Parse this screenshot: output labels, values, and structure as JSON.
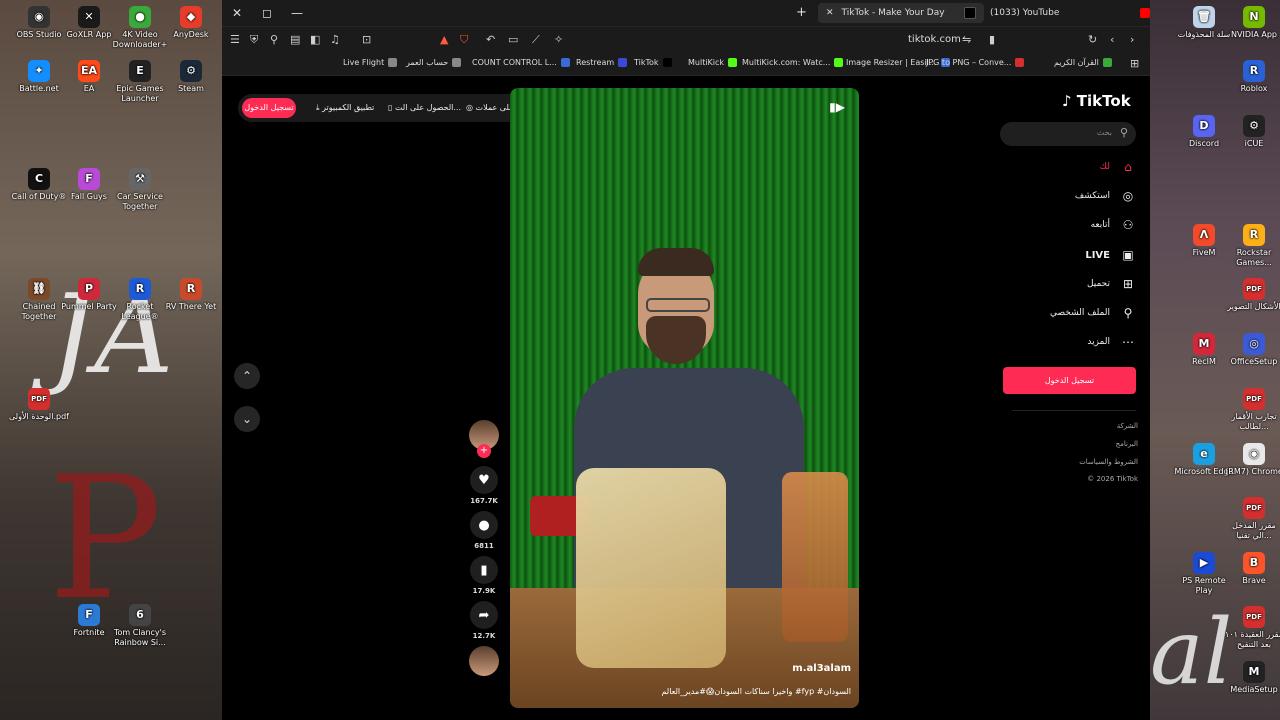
{
  "desktop": {
    "left_icons": [
      {
        "label": "OBS Studio",
        "color": "#333333",
        "glyph": "◉"
      },
      {
        "label": "GoXLR App",
        "color": "#1a1a1a",
        "glyph": "✕"
      },
      {
        "label": "4K Video Downloader+",
        "color": "#3aa83a",
        "glyph": "●"
      },
      {
        "label": "AnyDesk",
        "color": "#e63c2c",
        "glyph": "◆"
      },
      {
        "label": "Battle.net",
        "color": "#148eff",
        "glyph": "✦"
      },
      {
        "label": "EA",
        "color": "#ff4a1a",
        "glyph": "EA"
      },
      {
        "label": "Epic Games Launcher",
        "color": "#222222",
        "glyph": "E"
      },
      {
        "label": "Steam",
        "color": "#1b2838",
        "glyph": "⚙"
      },
      {
        "label": "Call of Duty®",
        "color": "#111111",
        "glyph": "C"
      },
      {
        "label": "Fall Guys",
        "color": "#b84ad6",
        "glyph": "F"
      },
      {
        "label": "Car Service Together",
        "color": "#666666",
        "glyph": "⚒"
      },
      {
        "label": "Chained Together",
        "color": "#7a4a2a",
        "glyph": "⛓"
      },
      {
        "label": "Pummel Party",
        "color": "#cc2a3a",
        "glyph": "P"
      },
      {
        "label": "Rocket League®",
        "color": "#1e5ad6",
        "glyph": "R"
      },
      {
        "label": "RV There Yet",
        "color": "#c84a2a",
        "glyph": "R"
      },
      {
        "label": "الوحدة الأولى.pdf",
        "color": "#d32f2f",
        "glyph": "PDF"
      },
      {
        "label": "Fortnite",
        "color": "#2a7ad6",
        "glyph": "F"
      },
      {
        "label": "Tom Clancy's Rainbow Si...",
        "color": "#444444",
        "glyph": "6"
      }
    ],
    "right_icons": [
      {
        "label": "سلة المحذوفات",
        "color": "#bfd4ea",
        "glyph": "🗑"
      },
      {
        "label": "NVIDIA App",
        "color": "#76b900",
        "glyph": "N"
      },
      {
        "label": "Roblox",
        "color": "#2a62d6",
        "glyph": "R"
      },
      {
        "label": "Discord",
        "color": "#5865f2",
        "glyph": "D"
      },
      {
        "label": "iCUE",
        "color": "#222222",
        "glyph": "⚙"
      },
      {
        "label": "FiveM",
        "color": "#f24a2a",
        "glyph": "Λ"
      },
      {
        "label": "Rockstar Games...",
        "color": "#fcaf17",
        "glyph": "R"
      },
      {
        "label": "الأشكال التصوير",
        "color": "#d32f2f",
        "glyph": "PDF"
      },
      {
        "label": "RecIM",
        "color": "#d6263a",
        "glyph": "M"
      },
      {
        "label": "OfficeSetup",
        "color": "#3a5ad6",
        "glyph": "◎"
      },
      {
        "label": "تجارب الأقمار ...لطالب",
        "color": "#d32f2f",
        "glyph": "PDF"
      },
      {
        "label": "Microsoft Edge",
        "color": "#1aa0e0",
        "glyph": "e"
      },
      {
        "label": "(RM7) Chrome",
        "color": "#e8e8e8",
        "glyph": "◉"
      },
      {
        "label": "مقرر المدخل ...الي تقنيا",
        "color": "#d32f2f",
        "glyph": "PDF"
      },
      {
        "label": "PS Remote Play",
        "color": "#1a4ad6",
        "glyph": "▶"
      },
      {
        "label": "Brave",
        "color": "#fb542b",
        "glyph": "B"
      },
      {
        "label": "مقرر العقيدة ١٠١ بعد التنقيح",
        "color": "#d32f2f",
        "glyph": "PDF"
      },
      {
        "label": "MediaSetup",
        "color": "#222222",
        "glyph": "M"
      }
    ],
    "deco_text": {
      "left_big": "JA",
      "left_red": "P",
      "right_big": "al"
    }
  },
  "browser": {
    "tabs": [
      {
        "label": "TikTok - Make Your Day",
        "active": true,
        "fav_color": "#000000"
      },
      {
        "label": "(1033) YouTube",
        "active": false,
        "fav_color": "#ff0000"
      }
    ],
    "window_controls": {
      "close": "✕",
      "maximize": "◻",
      "minimize": "—"
    },
    "new_tab": "+",
    "url": "tiktok.com",
    "bookmarks": [
      {
        "label": "Live Flight",
        "color": "#888888"
      },
      {
        "label": "حساب العمر",
        "color": "#888888"
      },
      {
        "label": "COUNT CONTROL L...",
        "color": "#3a6ad6"
      },
      {
        "label": "Restream",
        "color": "#3a4ad6"
      },
      {
        "label": "TikTok",
        "color": "#000000"
      },
      {
        "label": "MultiKick",
        "color": "#53fc18"
      },
      {
        "label": "MultiKick.com: Watc...",
        "color": "#53fc18"
      },
      {
        "label": "Image Resizer | Easil...",
        "color": "#3a6ad6"
      },
      {
        "label": "JPG to PNG – Conve...",
        "color": "#d32f2f"
      },
      {
        "label": "القرآن الكريم",
        "color": "#3aa83a"
      }
    ]
  },
  "tiktok": {
    "logo": "TikTok",
    "top_links": {
      "login": "تسجيل الدخول",
      "desktop_app": "تطبيق الكمبيوتر",
      "get_app": "الحصول على الت...",
      "coins": "احصل على عملات"
    },
    "search_placeholder": "بحث",
    "nav": [
      {
        "label": "لك",
        "icon": "home-icon",
        "glyph": "⌂",
        "active": true
      },
      {
        "label": "استكشف",
        "icon": "compass-icon",
        "glyph": "◎",
        "active": false
      },
      {
        "label": "أتابعه",
        "icon": "user-plus-icon",
        "glyph": "⚇",
        "active": false
      },
      {
        "label": "LIVE",
        "icon": "live-tv-icon",
        "glyph": "▣",
        "active": false
      },
      {
        "label": "تحميل",
        "icon": "upload-icon",
        "glyph": "⊞",
        "active": false
      },
      {
        "label": "الملف الشخصي",
        "icon": "profile-icon",
        "glyph": "⚲",
        "active": false
      },
      {
        "label": "المزيد",
        "icon": "more-icon",
        "glyph": "⋯",
        "active": false
      }
    ],
    "login_button": "تسجيل الدخول",
    "footer": {
      "company": "الشركة",
      "program": "البرنامج",
      "terms": "الشروط والسياسات",
      "copyright": "© 2026 TikTok"
    },
    "video": {
      "author": "m.al3alam",
      "caption": "واخيرا سناكات السودان😱#مدير_العالم #fyp #السودان"
    },
    "actions": {
      "likes": "167.7K",
      "comments": "6811",
      "saves": "17.9K",
      "shares": "12.7K"
    }
  },
  "colors": {
    "accent": "#fe2c55"
  }
}
